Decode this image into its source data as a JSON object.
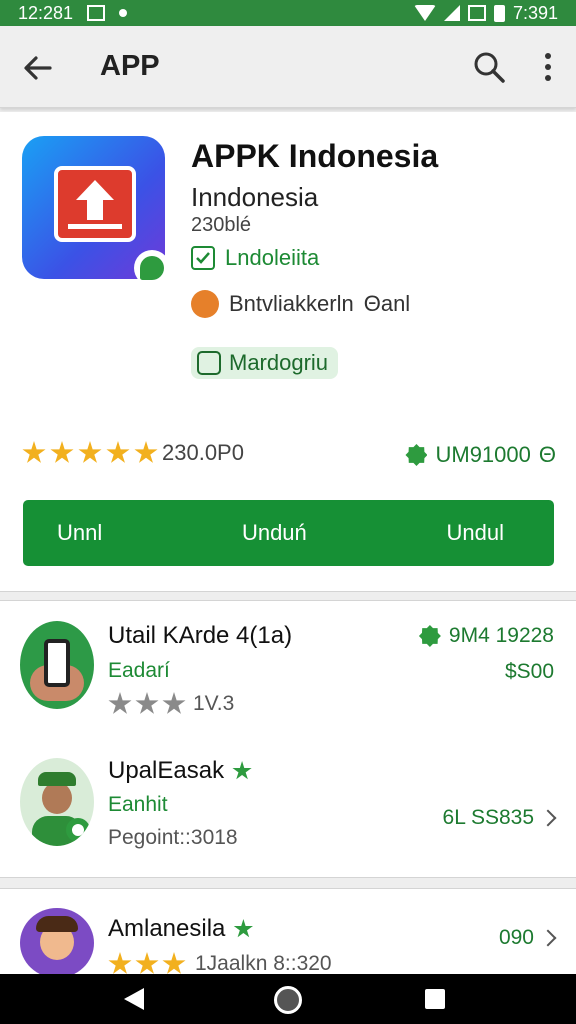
{
  "status_bar": {
    "time_left": "12:281",
    "time_right": "7:391"
  },
  "app_bar": {
    "title": "APP"
  },
  "app": {
    "title": "APPK Indonesia",
    "developer": "Inndonesia",
    "size": "230blé",
    "verified_label": "Lndoleiita",
    "category_label": "Bntvliakkerln",
    "category_suffix": "Θanl",
    "tag_label": "Mardogriu",
    "rating_count": "230.0P0",
    "stars_filled": 5,
    "price": "UM91000",
    "price_suffix": "Θ",
    "install_buttons": [
      "Unnl",
      "Unduń",
      "Undul"
    ]
  },
  "list": [
    {
      "title": "Utail KArde 4(1a)",
      "subtitle": "Eadarí",
      "meta": "1V.3",
      "stars_filled": 0,
      "stars_grey": 3,
      "price_top": "9M4 19228",
      "price": "$S00"
    },
    {
      "title": "UpalEasak",
      "subtitle": "Eanhit",
      "meta": "Pegoint::3018",
      "price": "6L SS835"
    },
    {
      "title": "Amlanesila",
      "subtitle": "",
      "meta": "1Jaalkn 8::320",
      "stars_filled": 3,
      "price": "090"
    }
  ],
  "icons": {
    "back": "arrow-left-icon",
    "search": "search-icon",
    "more": "more-vertical-icon",
    "verified": "verified-badge-icon",
    "nav_back": "triangle-back-icon",
    "nav_home": "circle-home-icon",
    "nav_recent": "square-recent-icon"
  },
  "colors": {
    "accent": "#169035",
    "status_bar": "#2f8a3e",
    "star": "#f2b01e"
  }
}
